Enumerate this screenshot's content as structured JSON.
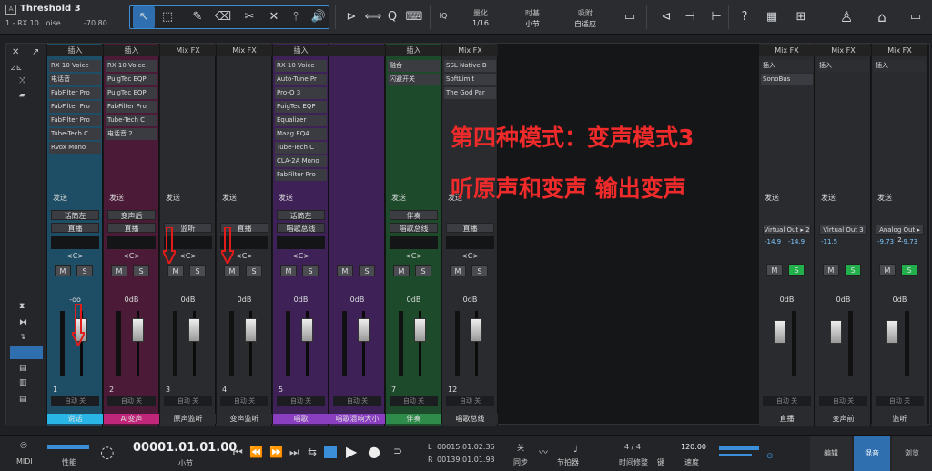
{
  "toolbar": {
    "track_title": "Threshold 3",
    "track_sub": "1 - RX 10 ..oise",
    "track_level": "-70.80",
    "quantize_label": "量化",
    "quantize_value": "1/16",
    "timebase_label": "时基",
    "timebase_value": "小节",
    "snap_label": "吸附",
    "snap_value": "自适应",
    "iq_label": "IQ"
  },
  "left_panel": {
    "close": "✕",
    "expand": "↗"
  },
  "channels": [
    {
      "id": "ch1",
      "hdr": "插入",
      "inserts": [
        "RX 10 Voice",
        "电话音",
        "FabFilter Pro",
        "FabFilter Pro",
        "FabFilter Pro",
        "Tube-Tech C",
        "RVox Mono"
      ],
      "send": "发送",
      "route": "话筒左",
      "route2": "直播",
      "pan": "<C>",
      "db": "-oo",
      "num": "1",
      "name": "说话",
      "color": "#29b6e6",
      "strip_bg": "#1e4e66"
    },
    {
      "id": "ch2",
      "hdr": "插入",
      "inserts": [
        "RX 10 Voice",
        "PuigTec EQP",
        "PuigTec EQP",
        "FabFilter Pro",
        "Tube-Tech C",
        "电话音 2"
      ],
      "send": "发送",
      "route": "变声后",
      "route2": "直播",
      "pan": "<C>",
      "db": "0dB",
      "num": "2",
      "name": "AI变声",
      "color": "#c0267a",
      "strip_bg": "#4a1a36"
    },
    {
      "id": "ch3",
      "hdr": "Mix FX",
      "inserts": [],
      "send": "发送",
      "route": "",
      "route2": "监听",
      "pan": "<C>",
      "db": "0dB",
      "num": "3",
      "name": "原声监听",
      "color": "#2b2c30",
      "strip_bg": "#2a2b2f"
    },
    {
      "id": "ch4",
      "hdr": "Mix FX",
      "inserts": [],
      "send": "发送",
      "route": "",
      "route2": "直播",
      "pan": "<C>",
      "db": "0dB",
      "num": "4",
      "name": "变声监听",
      "color": "#2b2c30",
      "strip_bg": "#2a2b2f"
    },
    {
      "id": "ch5",
      "hdr": "插入",
      "inserts": [
        "RX 10 Voice",
        "Auto-Tune Pr",
        "Pro-Q 3",
        "PuigTec EQP",
        "Equalizer",
        "Maag EQ4",
        "Tube-Tech C",
        "CLA-2A Mono",
        "FabFilter Pro"
      ],
      "send": "发送",
      "route": "话筒左",
      "route2": "唱歌总线",
      "pan": "<C>",
      "db": "0dB",
      "num": "5",
      "name": "唱歌",
      "color": "#8a3fc0",
      "strip_bg": "#3d2157"
    },
    {
      "id": "ch6",
      "hdr": "",
      "inserts": [],
      "send": "",
      "route": "",
      "route2": "",
      "pan": "",
      "db": "0dB",
      "num": "",
      "name": "唱歌混响大小",
      "color": "#8a3fc0",
      "strip_bg": "#3d2157"
    },
    {
      "id": "ch7",
      "hdr": "插入",
      "inserts": [
        "融合",
        "闪避开关"
      ],
      "send": "发送",
      "route": "伴奏",
      "route2": "唱歌总线",
      "pan": "<C>",
      "db": "0dB",
      "num": "7",
      "name": "伴奏",
      "color": "#2e8b4a",
      "strip_bg": "#1e4a2c"
    },
    {
      "id": "ch12",
      "hdr": "Mix FX",
      "inserts": [
        "SSL Native B",
        "SoftLimit",
        "The God Par"
      ],
      "send": "发送",
      "route": "",
      "route2": "直播",
      "pan": "<C>",
      "db": "0dB",
      "num": "12",
      "name": "唱歌总线",
      "color": "#2b2c30",
      "strip_bg": "#2a2b2f"
    }
  ],
  "outputs": [
    {
      "id": "out1",
      "hdr": "Mix FX",
      "insert_hdr": "插入",
      "inserts": [
        "SonoBus"
      ],
      "send": "发送",
      "route": "Virtual Out ▸ 2",
      "lvl_l": "-14.9",
      "lvl_r": "-14.9",
      "db": "0dB",
      "name": "直播"
    },
    {
      "id": "out2",
      "hdr": "Mix FX",
      "insert_hdr": "插入",
      "inserts": [],
      "send": "发送",
      "route": "Virtual Out 3",
      "lvl_l": "-11.5",
      "lvl_r": "",
      "db": "0dB",
      "name": "变声前"
    },
    {
      "id": "out3",
      "hdr": "Mix FX",
      "insert_hdr": "插入",
      "inserts": [],
      "send": "发送",
      "route": "Analog Out ▸ 2",
      "lvl_l": "-9.73",
      "lvl_r": "-9.73",
      "db": "0dB",
      "name": "监听"
    }
  ],
  "overlay": {
    "line1": "第四种模式：变声模式3",
    "line2": "听原声和变声  输出变声"
  },
  "common": {
    "auto_off": "自动 关",
    "mute": "M",
    "solo": "S"
  },
  "transport": {
    "midi": "MIDI",
    "perf": "性能",
    "time": "00001.01.01.00",
    "time_unit": "小节",
    "loop_l": "00015.01.02.36",
    "loop_r": "00139.01.01.93",
    "l_lbl": "L",
    "r_lbl": "R",
    "sync_lbl": "同步",
    "sync_val": "关",
    "metro": "节拍器",
    "sig": "4 / 4",
    "sig_lbl": "时间修整",
    "key_lbl": "键",
    "tempo": "120.00",
    "tempo_lbl": "速度",
    "btn_edit": "编辑",
    "btn_mix": "混音",
    "btn_browse": "浏览"
  }
}
